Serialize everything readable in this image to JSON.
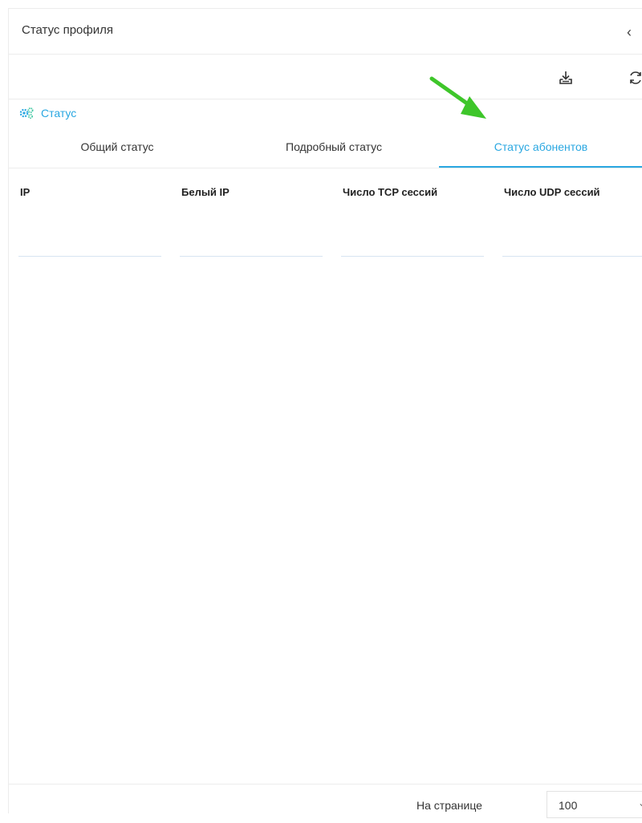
{
  "header": {
    "title": "Статус профиля",
    "collapse_icon": "chevron-left-icon"
  },
  "toolbar": {
    "buttons": [
      {
        "icon": "download-icon"
      },
      {
        "icon": "refresh-icon"
      }
    ]
  },
  "section": {
    "title": "Статус",
    "icon": "gears-icon",
    "accent_color": "#29a7e1"
  },
  "tabs": [
    {
      "label": "Общий статус",
      "active": false
    },
    {
      "label": "Подробный статус",
      "active": false
    },
    {
      "label": "Статус абонентов",
      "active": true
    }
  ],
  "table": {
    "columns": [
      "IP",
      "Белый IP",
      "Число TCP сессий",
      "Число UDP сессий"
    ],
    "rows": []
  },
  "footer": {
    "per_page_label": "На странице",
    "per_page_value": "100"
  },
  "annotation": {
    "icon": "green-arrow-icon",
    "color": "#3ec62a"
  }
}
